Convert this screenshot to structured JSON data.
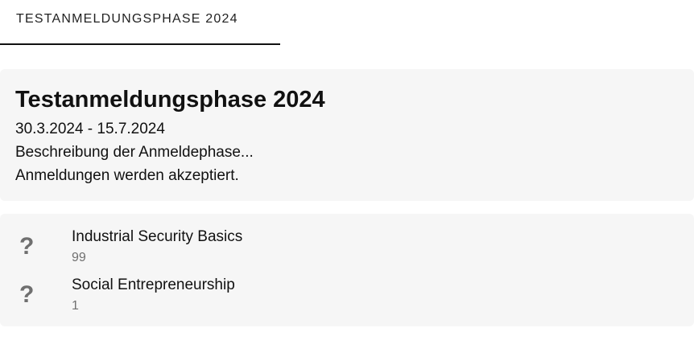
{
  "tabs": [
    {
      "label": "TESTANMELDUNGSPHASE 2024",
      "active": true
    }
  ],
  "phase": {
    "title": "Testanmeldungsphase 2024",
    "dates": "30.3.2024 - 15.7.2024",
    "description": "Beschreibung der Anmeldephase...",
    "status": "Anmeldungen werden akzeptiert."
  },
  "courses": [
    {
      "icon": "?",
      "icon_name": "question-mark-icon",
      "name": "Industrial Security Basics",
      "count": "99"
    },
    {
      "icon": "?",
      "icon_name": "question-mark-icon",
      "name": "Social Entrepreneurship",
      "count": "1"
    }
  ],
  "colors": {
    "card_background": "#f6f6f6",
    "icon": "#6f6f6f",
    "secondary_text": "#707070"
  }
}
